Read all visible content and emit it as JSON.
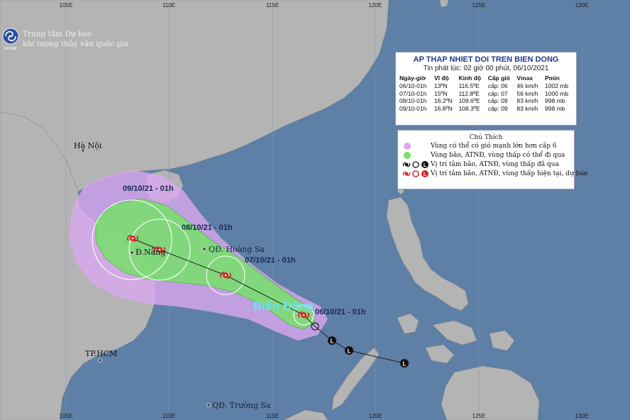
{
  "agency": {
    "line1": "Trung tâm Dự báo",
    "line2": "khí tượng thủy văn quốc gia",
    "logo_text": "NCHMF"
  },
  "longitude_labels": [
    "105E",
    "110E",
    "115E",
    "120E",
    "125E",
    "130E"
  ],
  "places": {
    "hanoi": "Hà Nội",
    "danang": "Đ.Nẵng",
    "hcm": "TP.HCM",
    "hoangsa": "QĐ. Hoàng Sa",
    "truongsa": "QĐ. Trường Sa",
    "sea": "Biển Đông"
  },
  "date_labels": {
    "d06": "06/10/21 - 01h",
    "d07": "07/10/21 - 01h",
    "d08": "08/10/21 - 01h",
    "d09": "09/10/21 - 01h"
  },
  "bulletin": {
    "title": "AP THAP NHIET DOI TREN BIEN DONG",
    "subtitle": "Tin phát lúc: 02 giờ 00 phút, 06/10/2021",
    "headers": [
      "Ngày-giờ",
      "Vĩ độ",
      "Kinh độ",
      "Cấp gió",
      "Vmax",
      "Pmin"
    ],
    "rows": [
      [
        "06/10-01h",
        "13ºN",
        "116.5ºE",
        "cấp: 06",
        "46 km/h",
        "1002 mb"
      ],
      [
        "07/10-01h",
        "15ºN",
        "112.8ºE",
        "cấp: 07",
        "56 km/h",
        "1000 mb"
      ],
      [
        "08/10-01h",
        "16.2ºN",
        "109.6ºE",
        "cấp: 09",
        "83 km/h",
        "998 mb"
      ],
      [
        "09/10-01h",
        "16.8ºN",
        "108.3ºE",
        "cấp: 09",
        "83 km/h",
        "998 mb"
      ]
    ]
  },
  "legend": {
    "title": "Chú Thích",
    "items": [
      "Vùng có thể có gió mạnh lớn hơn cấp 6",
      "Vùng bão, ATNĐ, vùng thấp có thể đi qua",
      "Vị trí tâm bão, ATNĐ, vùng thấp đã qua",
      "Vị trí tâm bão, ATNĐ, vùng thấp hiện tại, dự báo"
    ],
    "low_glyph": "L"
  },
  "colors": {
    "sea": "#5e7fa6",
    "land": "#b4b4b4",
    "purple_zone": "#d9a8f0",
    "green_zone": "#77e06a",
    "track_red": "#e0202a",
    "past_black": "#111111"
  }
}
